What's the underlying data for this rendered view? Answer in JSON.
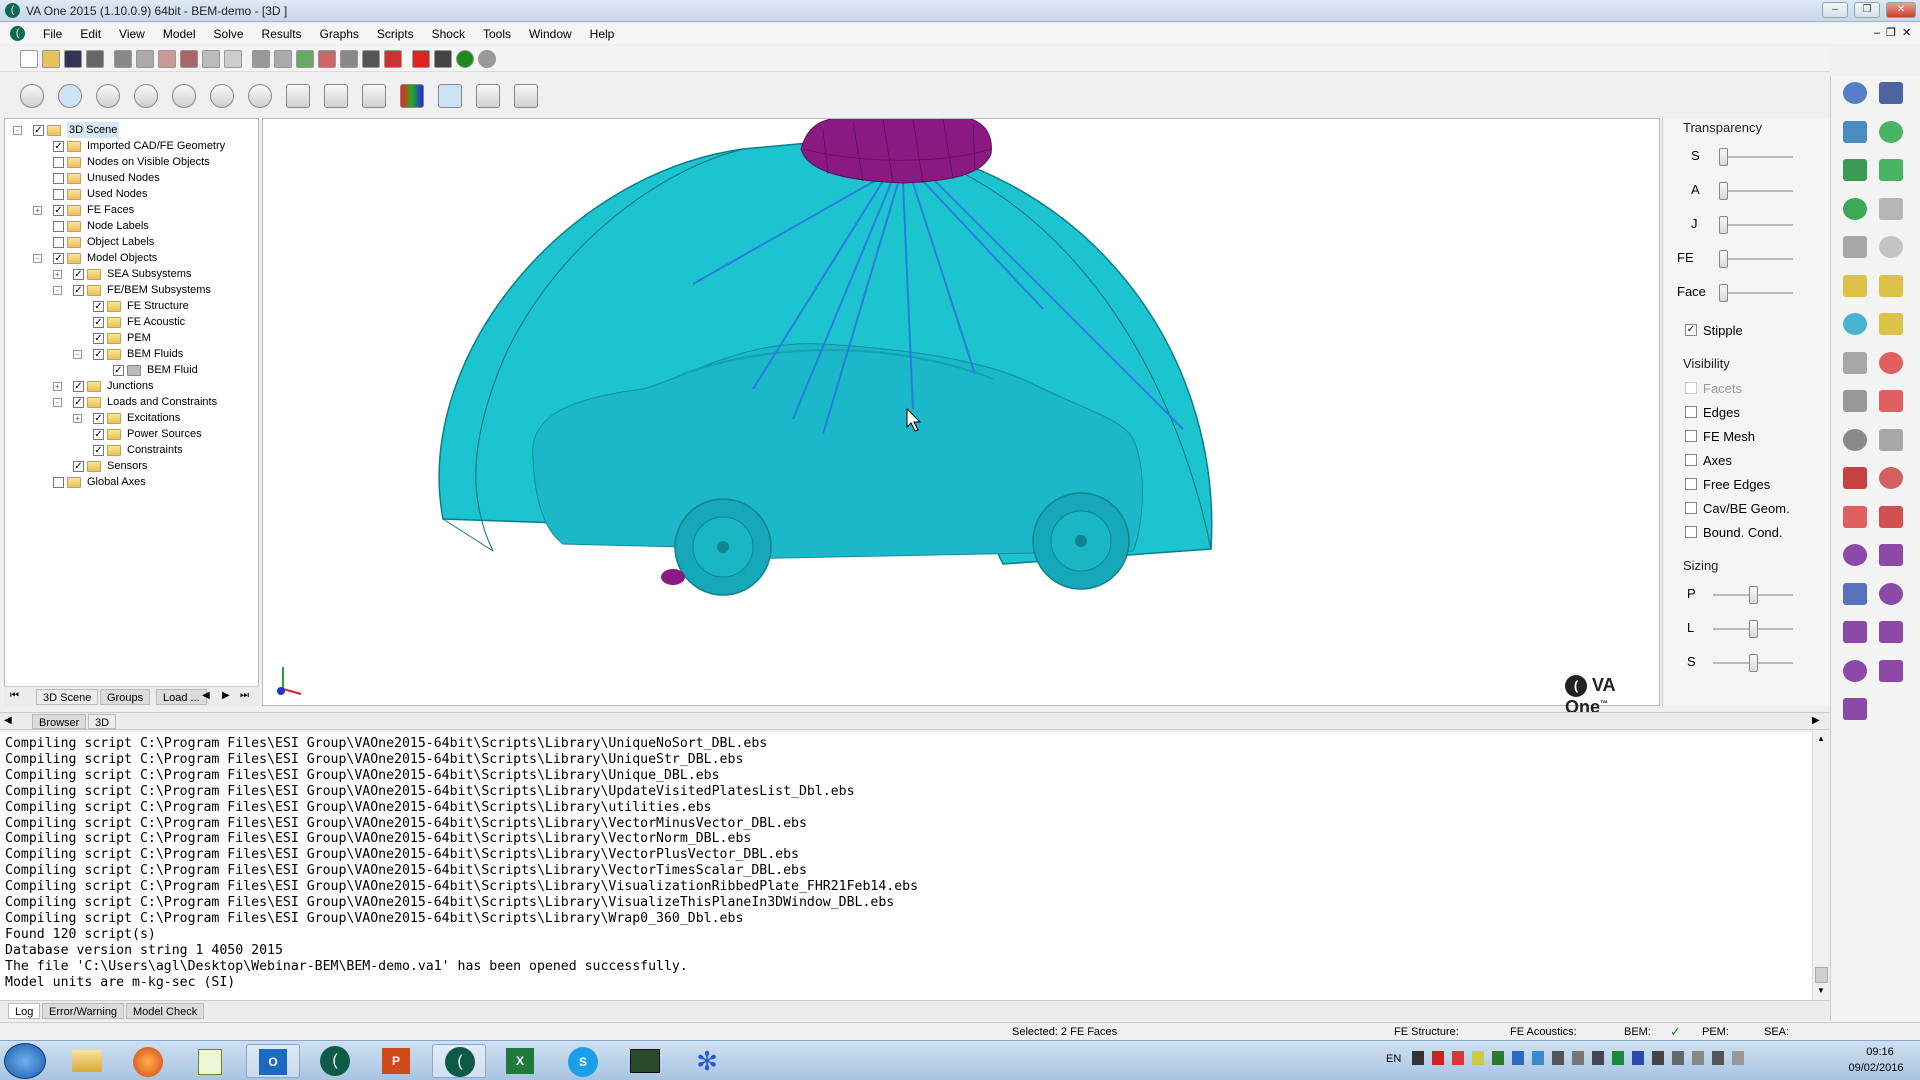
{
  "window": {
    "title": "VA One 2015 (1.10.0.9) 64bit - BEM-demo - [3D ]"
  },
  "menu": [
    "File",
    "Edit",
    "View",
    "Model",
    "Solve",
    "Results",
    "Graphs",
    "Scripts",
    "Shock",
    "Tools",
    "Window",
    "Help"
  ],
  "tree": [
    {
      "label": "3D Scene",
      "indent": 0,
      "exp": "-",
      "checked": true
    },
    {
      "label": "Imported CAD/FE Geometry",
      "indent": 1,
      "exp": "",
      "checked": true
    },
    {
      "label": "Nodes on Visible Objects",
      "indent": 1,
      "exp": "",
      "checked": false
    },
    {
      "label": "Unused Nodes",
      "indent": 1,
      "exp": "",
      "checked": false
    },
    {
      "label": "Used Nodes",
      "indent": 1,
      "exp": "",
      "checked": false
    },
    {
      "label": "FE Faces",
      "indent": 1,
      "exp": "+",
      "checked": true
    },
    {
      "label": "Node Labels",
      "indent": 1,
      "exp": "",
      "checked": false
    },
    {
      "label": "Object Labels",
      "indent": 1,
      "exp": "",
      "checked": false
    },
    {
      "label": "Model Objects",
      "indent": 1,
      "exp": "-",
      "checked": true
    },
    {
      "label": "SEA Subsystems",
      "indent": 2,
      "exp": "+",
      "checked": true
    },
    {
      "label": "FE/BEM Subsystems",
      "indent": 2,
      "exp": "-",
      "checked": true
    },
    {
      "label": "FE Structure",
      "indent": 3,
      "exp": "",
      "checked": true
    },
    {
      "label": "FE Acoustic",
      "indent": 3,
      "exp": "",
      "checked": true
    },
    {
      "label": "PEM",
      "indent": 3,
      "exp": "",
      "checked": true
    },
    {
      "label": "BEM Fluids",
      "indent": 3,
      "exp": "-",
      "checked": true
    },
    {
      "label": "BEM Fluid",
      "indent": 4,
      "exp": "",
      "checked": true
    },
    {
      "label": "Junctions",
      "indent": 2,
      "exp": "+",
      "checked": true
    },
    {
      "label": "Loads and Constraints",
      "indent": 2,
      "exp": "-",
      "checked": true
    },
    {
      "label": "Excitations",
      "indent": 3,
      "exp": "+",
      "checked": true
    },
    {
      "label": "Power Sources",
      "indent": 3,
      "exp": "",
      "checked": true
    },
    {
      "label": "Constraints",
      "indent": 3,
      "exp": "",
      "checked": true
    },
    {
      "label": "Sensors",
      "indent": 2,
      "exp": "",
      "checked": true
    },
    {
      "label": "Global Axes",
      "indent": 1,
      "exp": "",
      "checked": false
    }
  ],
  "tree_tabs": [
    "3D Scene",
    "Groups",
    "Load ..."
  ],
  "browser_tabs": [
    "Browser",
    "3D"
  ],
  "transparency": {
    "title": "Transparency",
    "sliders": [
      {
        "label": "S",
        "value": 0
      },
      {
        "label": "A",
        "value": 0
      },
      {
        "label": "J",
        "value": 0
      },
      {
        "label": "FE",
        "value": 0
      },
      {
        "label": "Face",
        "value": 0
      }
    ],
    "stipple": {
      "label": "Stipple",
      "checked": true
    }
  },
  "visibility": {
    "title": "Visibility",
    "items": [
      {
        "label": "Facets",
        "checked": false,
        "disabled": true
      },
      {
        "label": "Edges",
        "checked": false,
        "disabled": false
      },
      {
        "label": "FE Mesh",
        "checked": false,
        "disabled": false
      },
      {
        "label": "Axes",
        "checked": false,
        "disabled": false
      },
      {
        "label": "Free Edges",
        "checked": false,
        "disabled": false
      },
      {
        "label": "Cav/BE Geom.",
        "checked": false,
        "disabled": false
      },
      {
        "label": "Bound. Cond.",
        "checked": false,
        "disabled": false
      }
    ]
  },
  "sizing": {
    "title": "Sizing",
    "sliders": [
      {
        "label": "P",
        "value": 0.5
      },
      {
        "label": "L",
        "value": 0.5
      },
      {
        "label": "S",
        "value": 0.5
      }
    ]
  },
  "logo": "VA One",
  "log_lines": [
    "Compiling script C:\\Program Files\\ESI Group\\VAOne2015-64bit\\Scripts\\Library\\UniqueNoSort_DBL.ebs",
    "Compiling script C:\\Program Files\\ESI Group\\VAOne2015-64bit\\Scripts\\Library\\UniqueStr_DBL.ebs",
    "Compiling script C:\\Program Files\\ESI Group\\VAOne2015-64bit\\Scripts\\Library\\Unique_DBL.ebs",
    "Compiling script C:\\Program Files\\ESI Group\\VAOne2015-64bit\\Scripts\\Library\\UpdateVisitedPlatesList_Dbl.ebs",
    "Compiling script C:\\Program Files\\ESI Group\\VAOne2015-64bit\\Scripts\\Library\\utilities.ebs",
    "Compiling script C:\\Program Files\\ESI Group\\VAOne2015-64bit\\Scripts\\Library\\VectorMinusVector_DBL.ebs",
    "Compiling script C:\\Program Files\\ESI Group\\VAOne2015-64bit\\Scripts\\Library\\VectorNorm_DBL.ebs",
    "Compiling script C:\\Program Files\\ESI Group\\VAOne2015-64bit\\Scripts\\Library\\VectorPlusVector_DBL.ebs",
    "Compiling script C:\\Program Files\\ESI Group\\VAOne2015-64bit\\Scripts\\Library\\VectorTimesScalar_DBL.ebs",
    "Compiling script C:\\Program Files\\ESI Group\\VAOne2015-64bit\\Scripts\\Library\\VisualizationRibbedPlate_FHR21Feb14.ebs",
    "Compiling script C:\\Program Files\\ESI Group\\VAOne2015-64bit\\Scripts\\Library\\VisualizeThisPlaneIn3DWindow_DBL.ebs",
    "Compiling script C:\\Program Files\\ESI Group\\VAOne2015-64bit\\Scripts\\Library\\Wrap0_360_Dbl.ebs",
    "Found 120 script(s)",
    "Database version string 1 4050 2015",
    "The file 'C:\\Users\\agl\\Desktop\\Webinar-BEM\\BEM-demo.va1' has been opened successfully.",
    "Model units are m-kg-sec (SI)"
  ],
  "log_tabs": [
    "Log",
    "Error/Warning",
    "Model Check"
  ],
  "status": {
    "selected": "Selected: 2 FE Faces",
    "fe_structure": "FE Structure:",
    "fe_acoustics": "FE Acoustics:",
    "bem": "BEM:",
    "bem_check": "✓",
    "pem": "PEM:",
    "sea": "SEA:"
  },
  "tray": {
    "lang": "EN",
    "time": "09:16",
    "date": "09/02/2016"
  },
  "colors": {
    "car": "#1ab8c8",
    "dome": "#1cc4d0",
    "source": "#8a1a82",
    "rays": "#2a7be0"
  }
}
